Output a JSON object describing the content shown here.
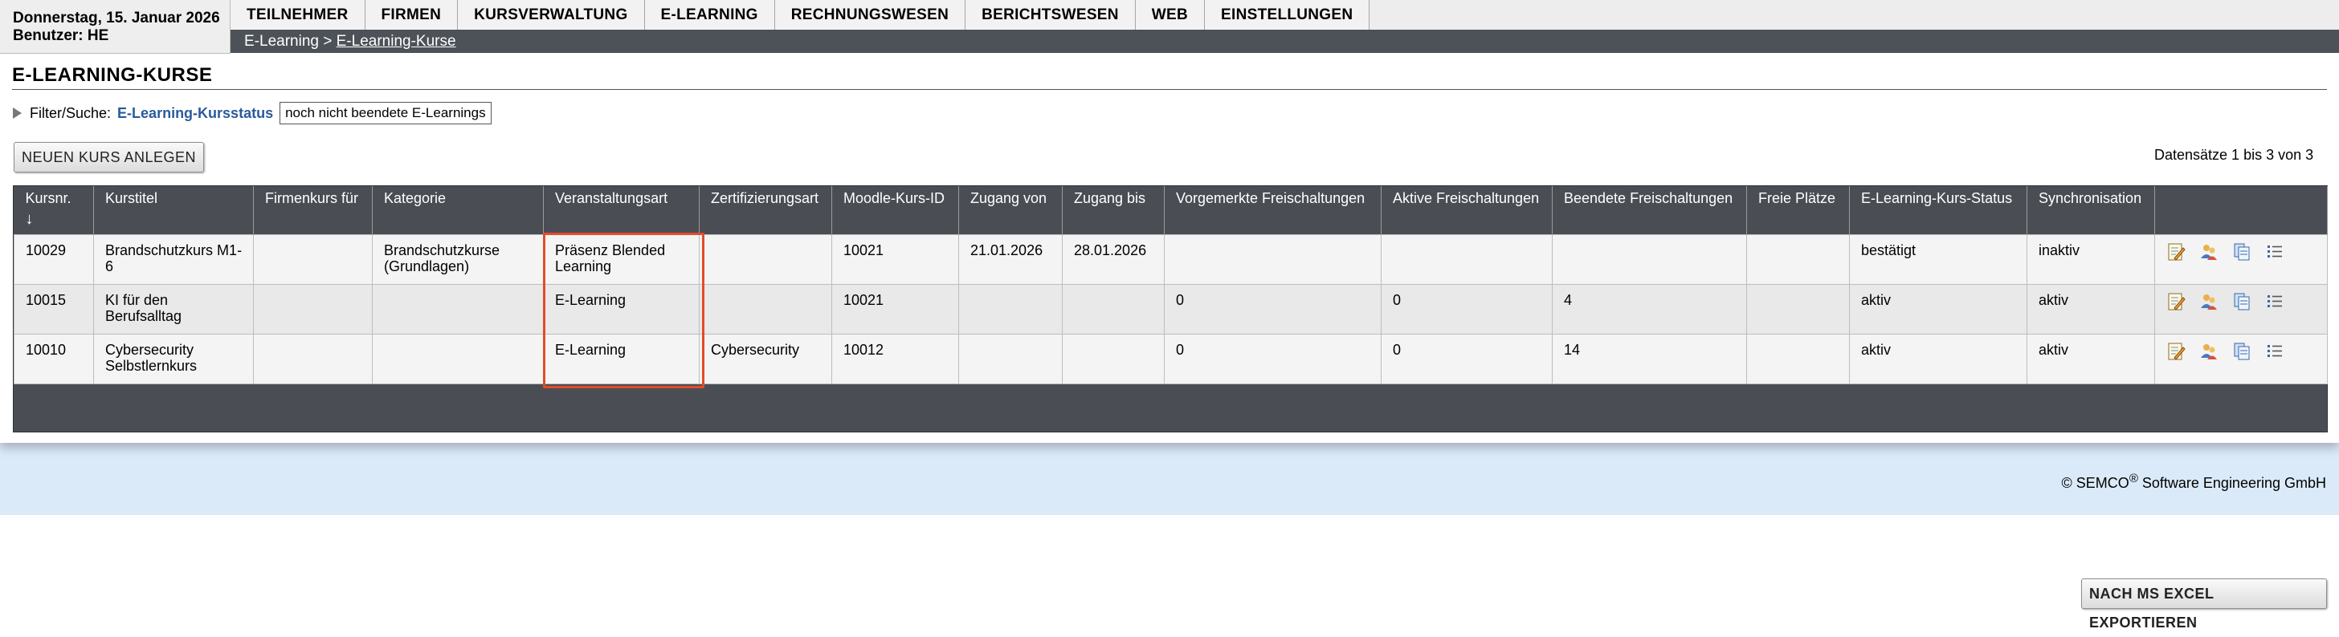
{
  "header": {
    "date": "Donnerstag, 15. Januar 2026",
    "user": "Benutzer: HE"
  },
  "menu": [
    "TEILNEHMER",
    "FIRMEN",
    "KURSVERWALTUNG",
    "E-LEARNING",
    "RECHNUNGSWESEN",
    "BERICHTSWESEN",
    "WEB",
    "EINSTELLUNGEN"
  ],
  "breadcrumb": {
    "parent": "E-Learning",
    "separator": ">",
    "current": "E-Learning-Kurse"
  },
  "page": {
    "title": "E-LEARNING-KURSE"
  },
  "filter": {
    "label": "Filter/Suche:",
    "status_label": "E-Learning-Kursstatus",
    "status_value": "noch nicht beendete E-Learnings"
  },
  "actions": {
    "new_course": "NEUEN KURS ANLEGEN",
    "export": "NACH MS EXCEL EXPORTIEREN",
    "records_info": "Datensätze 1 bis 3 von 3"
  },
  "table": {
    "sort_indicator": "↓",
    "columns": [
      "Kursnr.",
      "Kurstitel",
      "Firmenkurs für",
      "Kategorie",
      "Veranstaltungsart",
      "Zertifizierungsart",
      "Moodle-Kurs-ID",
      "Zugang von",
      "Zugang bis",
      "Vorgemerkte Freischaltungen",
      "Aktive Freischaltungen",
      "Beendete Freischaltungen",
      "Freie Plätze",
      "E-Learning-Kurs-Status",
      "Synchronisation",
      ""
    ],
    "rows": [
      [
        "10029",
        "Brandschutzkurs M1-6",
        "",
        "Brandschutzkurse (Grundlagen)",
        "Präsenz Blended Learning",
        "",
        "10021",
        "21.01.2026",
        "28.01.2026",
        "",
        "",
        "",
        "",
        "bestätigt",
        "inaktiv"
      ],
      [
        "10015",
        "KI für den Berufsalltag",
        "",
        "",
        "E-Learning",
        "",
        "10021",
        "",
        "",
        "0",
        "0",
        "4",
        "",
        "aktiv",
        "aktiv"
      ],
      [
        "10010",
        "Cybersecurity Selbstlernkurs",
        "",
        "",
        "E-Learning",
        "Cybersecurity",
        "10012",
        "",
        "",
        "0",
        "0",
        "14",
        "",
        "aktiv",
        "aktiv"
      ]
    ],
    "row_icons": [
      "edit-icon",
      "users-icon",
      "copy-icon",
      "list-icon"
    ]
  },
  "footer": {
    "copyright_prefix": "© SEMCO",
    "registered": "®",
    "copyright_suffix": " Software Engineering GmbH"
  }
}
